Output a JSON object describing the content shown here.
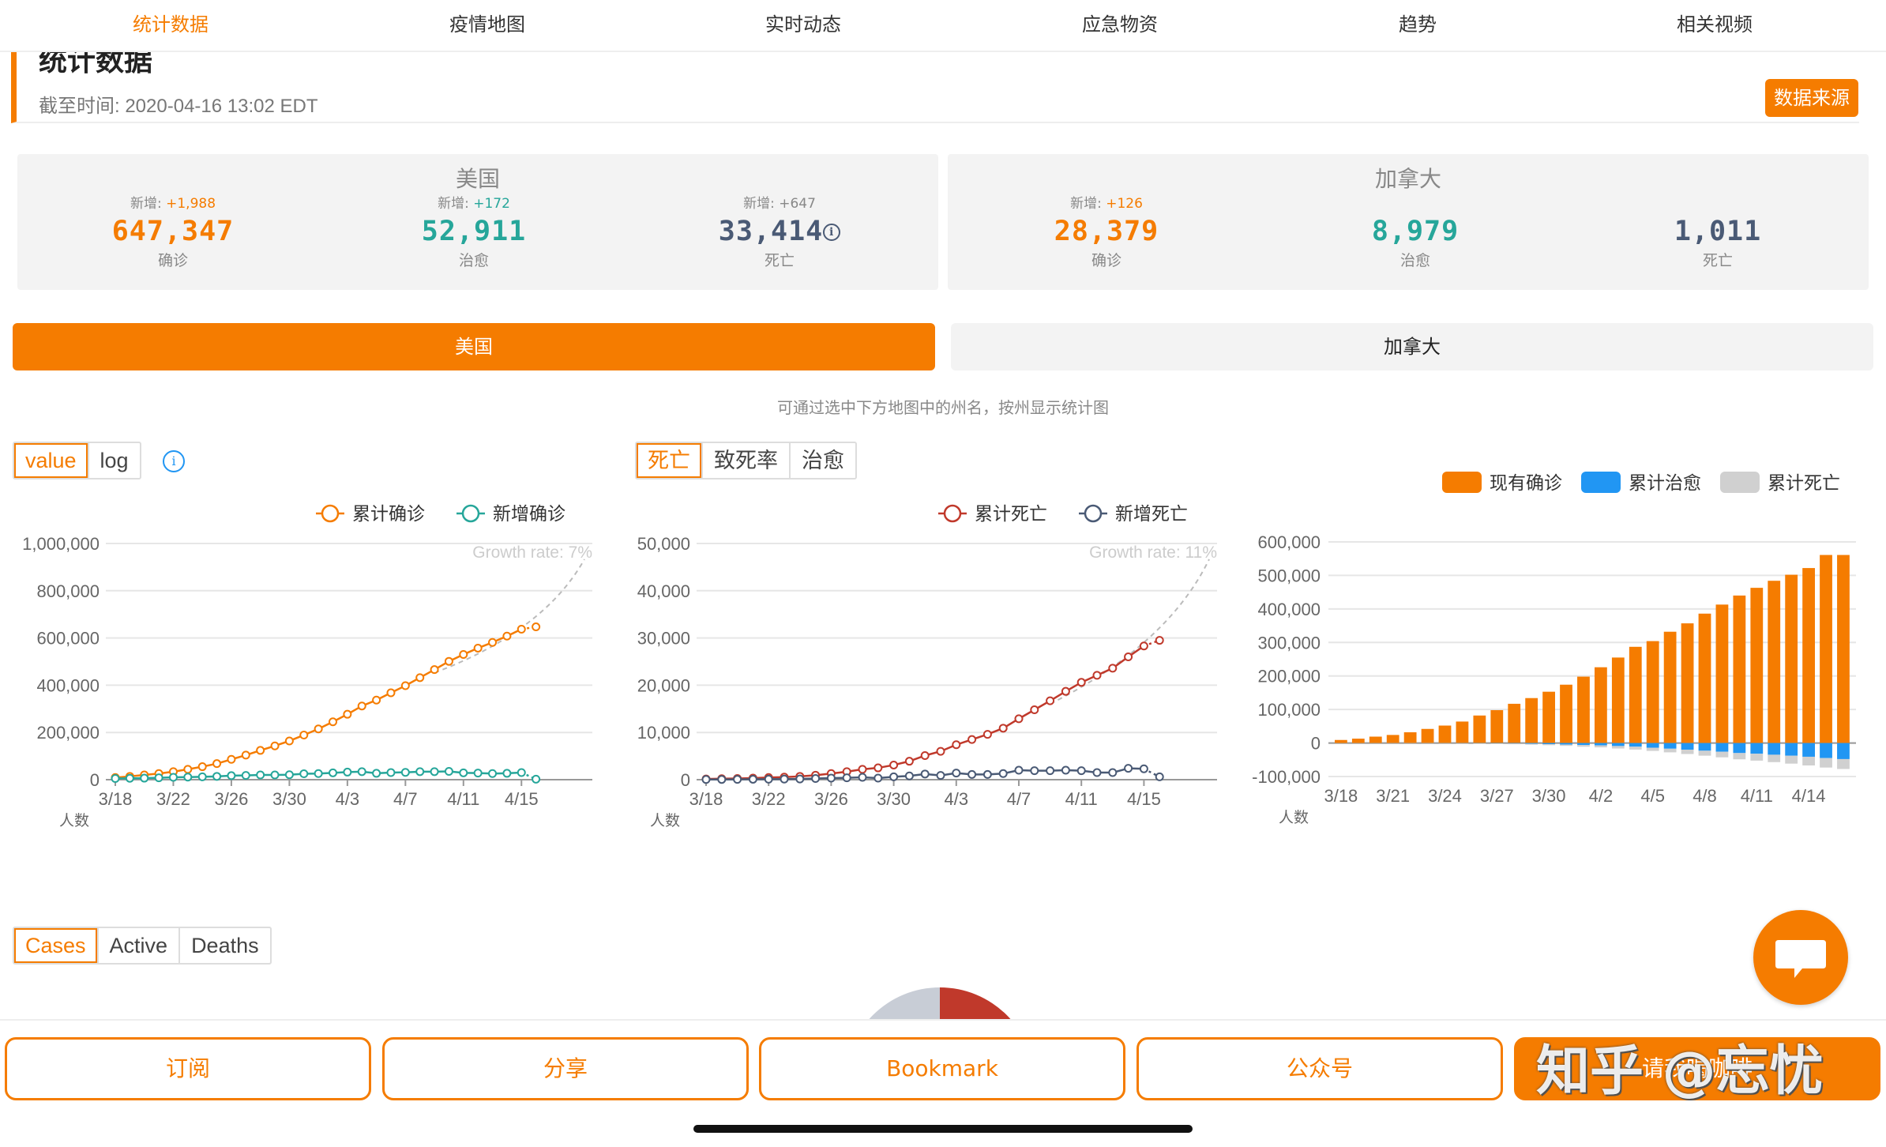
{
  "tabs": [
    "统计数据",
    "疫情地图",
    "实时动态",
    "应急物资",
    "趋势",
    "相关视频"
  ],
  "header": {
    "title": "统计数据",
    "timestamp": "截至时间: 2020-04-16 13:02 EDT",
    "source_button": "数据来源"
  },
  "usa": {
    "title": "美国",
    "confirmed": {
      "new_label": "新增:",
      "new_value": "+1,988",
      "value": "647,347",
      "label": "确诊"
    },
    "recovered": {
      "new_label": "新增:",
      "new_value": "+172",
      "value": "52,911",
      "label": "治愈"
    },
    "deaths": {
      "new_label": "新增:",
      "new_value": "+647",
      "value": "33,414",
      "label": "死亡",
      "info_icon": "ⓘ"
    }
  },
  "canada": {
    "title": "加拿大",
    "confirmed": {
      "new_label": "新增:",
      "new_value": "+126",
      "value": "28,379",
      "label": "确诊"
    },
    "recovered": {
      "value": "8,979",
      "label": "治愈"
    },
    "deaths": {
      "value": "1,011",
      "label": "死亡"
    }
  },
  "country_buttons": {
    "usa": "美国",
    "canada": "加拿大",
    "selected": "美国"
  },
  "hint": "可通过选中下方地图中的州名，按州显示统计图",
  "controls": {
    "scale": [
      "value",
      "log"
    ],
    "scale_selected": "value",
    "death_mode": [
      "死亡",
      "致死率",
      "治愈"
    ],
    "death_mode_selected": "死亡",
    "map_mode": [
      "Cases",
      "Active",
      "Deaths"
    ],
    "map_mode_selected": "Cases"
  },
  "colors": {
    "accent": "#f57c00",
    "teal": "#26a69a",
    "slate": "#4a5a75",
    "death_red": "#c0392b",
    "recovered_blue": "#2196f3",
    "dead_gray": "#d0d0d0"
  },
  "chart_data": [
    {
      "type": "line",
      "title": "",
      "ylabel": "人数",
      "ylim": [
        0,
        1000000
      ],
      "yticks": [
        "1,000,000",
        "800,000",
        "600,000",
        "400,000",
        "200,000",
        "0"
      ],
      "xticks": [
        "3/18",
        "3/22",
        "3/26",
        "3/30",
        "4/3",
        "4/7",
        "4/11",
        "4/15"
      ],
      "x_days": [
        "3/18",
        "3/19",
        "3/20",
        "3/21",
        "3/22",
        "3/23",
        "3/24",
        "3/25",
        "3/26",
        "3/27",
        "3/28",
        "3/29",
        "3/30",
        "3/31",
        "4/1",
        "4/2",
        "4/3",
        "4/4",
        "4/5",
        "4/6",
        "4/7",
        "4/8",
        "4/9",
        "4/10",
        "4/11",
        "4/12",
        "4/13",
        "4/14",
        "4/15",
        "4/16"
      ],
      "growth_label": "Growth rate: 7%",
      "series": [
        {
          "name": "累计确诊",
          "color": "#f57c00",
          "values": [
            9000,
            14000,
            20000,
            26000,
            34000,
            44000,
            55000,
            68000,
            86000,
            104000,
            124000,
            143000,
            164000,
            189000,
            215000,
            245000,
            277000,
            312000,
            337000,
            368000,
            398000,
            432000,
            466000,
            501000,
            530000,
            557000,
            581000,
            608000,
            637000,
            647000
          ]
        },
        {
          "name": "新增确诊",
          "color": "#26a69a",
          "values": [
            5000,
            6000,
            6500,
            8000,
            10000,
            11000,
            12000,
            14000,
            17000,
            18000,
            20000,
            20000,
            21000,
            25000,
            26000,
            29000,
            32000,
            34000,
            27000,
            30000,
            31000,
            34000,
            34000,
            35000,
            29000,
            28000,
            26000,
            27000,
            30000,
            2000
          ]
        }
      ]
    },
    {
      "type": "line",
      "title": "",
      "ylabel": "人数",
      "ylim": [
        0,
        50000
      ],
      "yticks": [
        "50,000",
        "40,000",
        "30,000",
        "20,000",
        "10,000",
        "0"
      ],
      "xticks": [
        "3/18",
        "3/22",
        "3/26",
        "3/30",
        "4/3",
        "4/7",
        "4/11",
        "4/15"
      ],
      "growth_label": "Growth rate: 11%",
      "series": [
        {
          "name": "累计死亡",
          "color": "#c0392b",
          "values": [
            150,
            200,
            250,
            340,
            450,
            550,
            700,
            950,
            1300,
            1700,
            2200,
            2500,
            3100,
            3900,
            5100,
            6000,
            7400,
            8500,
            9600,
            10900,
            12900,
            14800,
            16700,
            18700,
            20600,
            22100,
            23600,
            26000,
            28300,
            29500
          ]
        },
        {
          "name": "新增死亡",
          "color": "#4a5a75",
          "values": [
            40,
            50,
            60,
            90,
            110,
            120,
            150,
            250,
            330,
            400,
            500,
            330,
            600,
            800,
            1200,
            900,
            1400,
            1100,
            1100,
            1300,
            2000,
            1900,
            1900,
            2000,
            1900,
            1500,
            1500,
            2400,
            2300,
            600
          ]
        }
      ]
    },
    {
      "type": "bar",
      "title": "",
      "ylabel": "人数",
      "ylim": [
        -100000,
        600000
      ],
      "yticks": [
        "600,000",
        "500,000",
        "400,000",
        "300,000",
        "200,000",
        "100,000",
        "0",
        "-100,000"
      ],
      "xticks": [
        "3/18",
        "3/21",
        "3/24",
        "3/27",
        "3/30",
        "4/2",
        "4/5",
        "4/8",
        "4/11",
        "4/14"
      ],
      "legend": [
        "现有确诊",
        "累计治愈",
        "累计死亡"
      ],
      "series": [
        {
          "name": "现有确诊",
          "color": "#f57c00",
          "values": [
            9000,
            13000,
            19000,
            24000,
            32000,
            42000,
            52000,
            64000,
            82000,
            98000,
            117000,
            134000,
            153000,
            174000,
            198000,
            226000,
            255000,
            287000,
            304000,
            332000,
            357000,
            386000,
            413000,
            440000,
            463000,
            484000,
            502000,
            522000,
            561000,
            561000
          ]
        },
        {
          "name": "累计治愈",
          "color": "#2196f3",
          "values": [
            -100,
            -150,
            -200,
            -300,
            -400,
            -500,
            -600,
            -700,
            -800,
            -1000,
            -1500,
            -2500,
            -3500,
            -4500,
            -6000,
            -7000,
            -9000,
            -11000,
            -14000,
            -17000,
            -20000,
            -23000,
            -26000,
            -30000,
            -32000,
            -35000,
            -38000,
            -41000,
            -45000,
            -48000
          ]
        },
        {
          "name": "累计死亡",
          "color": "#d0d0d0",
          "values": [
            -150,
            -200,
            -250,
            -340,
            -450,
            -550,
            -700,
            -950,
            -1300,
            -1700,
            -2200,
            -2500,
            -3100,
            -3900,
            -5100,
            -6000,
            -7400,
            -8500,
            -9600,
            -10900,
            -12900,
            -14800,
            -16700,
            -18700,
            -20600,
            -22100,
            -23600,
            -26000,
            -28300,
            -29500
          ]
        }
      ]
    }
  ],
  "bottom_bar": [
    "订阅",
    "分享",
    "Bookmark",
    "公众号",
    "请我喝咖啡"
  ],
  "watermark": "知乎 @忘忧"
}
